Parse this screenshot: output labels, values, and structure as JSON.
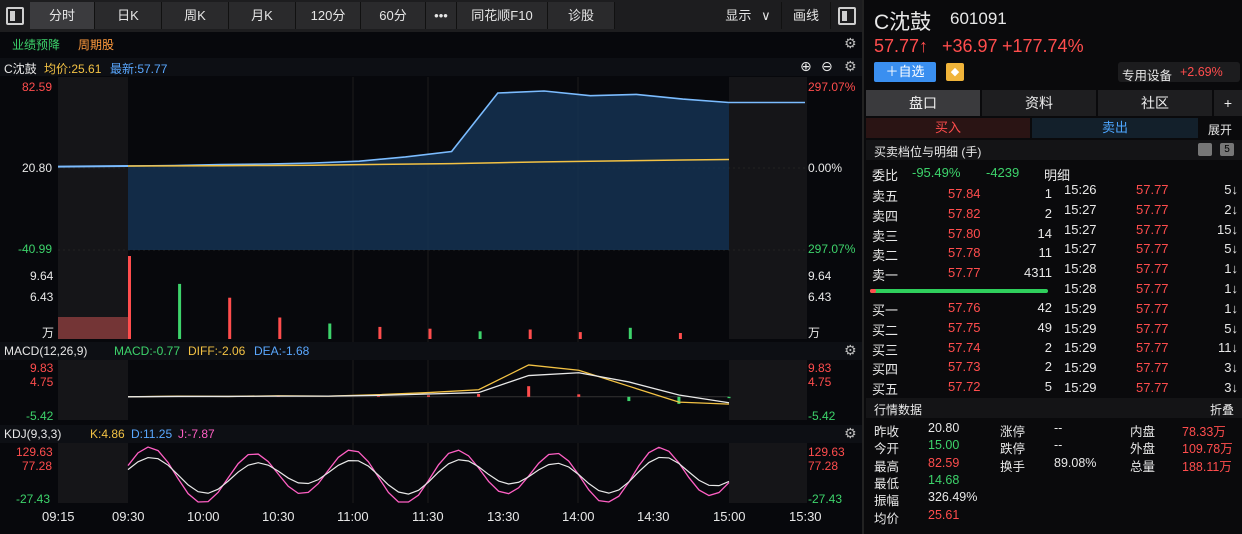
{
  "toolbar": {
    "tabs": [
      "分时",
      "日K",
      "周K",
      "月K",
      "120分",
      "60分",
      "•••",
      "同花顺F10",
      "诊股"
    ],
    "active": "分时",
    "show_label": "显示",
    "draw_label": "画线"
  },
  "chart": {
    "tags": [
      "业绩预降",
      "周期股"
    ],
    "stock_short": "C沈鼓",
    "avg_price_label": "均价:25.61",
    "latest_label": "最新:57.77",
    "price_axis_left": [
      "82.59",
      "20.80",
      "-40.99"
    ],
    "price_axis_right": [
      "297.07%",
      "0.00%",
      "297.07%"
    ],
    "vol_axis_left": [
      "9.64",
      "6.43",
      "万"
    ],
    "vol_axis_right": [
      "9.64",
      "6.43",
      "万"
    ],
    "macd_title": "MACD(12,26,9)",
    "macd_value": "MACD:-0.77",
    "diff_value": "DIFF:-2.06",
    "dea_value": "DEA:-1.68",
    "macd_axis_left": [
      "9.83",
      "4.75",
      "-5.42"
    ],
    "macd_axis_right": [
      "9.83",
      "4.75",
      "-5.42"
    ],
    "kdj_title": "KDJ(9,3,3)",
    "k_value": "K:4.86",
    "d_value": "D:11.25",
    "j_value": "J:-7.87",
    "kdj_axis_left": [
      "129.63",
      "77.28",
      "-27.43"
    ],
    "kdj_axis_right": [
      "129.63",
      "77.28",
      "-27.43"
    ],
    "time_axis": [
      "09:15",
      "09:30",
      "10:00",
      "10:30",
      "11:00",
      "11:30",
      "13:30",
      "14:00",
      "14:30",
      "15:00",
      "15:30"
    ]
  },
  "chart_data": {
    "type": "line",
    "x": [
      "09:30",
      "10:00",
      "10:30",
      "11:00",
      "11:30",
      "13:00",
      "13:15",
      "13:30",
      "13:45",
      "14:00",
      "14:15",
      "14:30",
      "14:45",
      "15:00"
    ],
    "series": [
      {
        "values": [
          20.8,
          21.2,
          21.8,
          22.3,
          23.0,
          24.3,
          27.5,
          31.5,
          74.5,
          76.0,
          72.5,
          73.5,
          70.0,
          67.5
        ]
      },
      {
        "values": [
          20.8,
          20.9,
          21.0,
          21.2,
          21.4,
          21.8,
          22.2,
          22.6,
          23.2,
          23.8,
          24.3,
          24.8,
          25.2,
          25.61
        ]
      }
    ],
    "ylim": [
      -40.99,
      82.59
    ],
    "volume": [
      9.64,
      6.4,
      4.8,
      2.5,
      1.8,
      1.4,
      1.2,
      0.9,
      1.1,
      0.8,
      1.3,
      0.7
    ],
    "macd": {
      "dif": [
        0,
        0.2,
        0.1,
        0.3,
        0.2,
        0.6,
        1.2,
        2.0,
        9.0,
        7.5,
        3.0,
        -1.5,
        -2.06
      ],
      "dea": [
        0,
        0.1,
        0.1,
        0.2,
        0.2,
        0.4,
        0.8,
        1.2,
        6.0,
        6.8,
        4.2,
        0.5,
        -1.68
      ],
      "ylim": [
        -5.42,
        9.83
      ]
    },
    "kdj": {
      "ylim": [
        -27.43,
        129.63
      ]
    }
  },
  "right": {
    "name": "C沈鼓",
    "code": "601091",
    "price": "57.77↑",
    "change": "+36.97",
    "change_pct": "+177.74%",
    "add_btn": "＋自选",
    "sector_name": "专用设备",
    "sector_pct": "+2.69%",
    "tabs": [
      "盘口",
      "资料",
      "社区"
    ],
    "plus": "+",
    "buy_btn": "买入",
    "sell_btn": "卖出",
    "expand": "展开",
    "section_title": "买卖档位与明细 (手)",
    "weibi_label": "委比",
    "weibi_pct": "-95.49%",
    "weibi_val": "-4239",
    "detail_label": "明细",
    "asks": [
      {
        "label": "卖五",
        "price": "57.84",
        "vol": "1"
      },
      {
        "label": "卖四",
        "price": "57.82",
        "vol": "2"
      },
      {
        "label": "卖三",
        "price": "57.80",
        "vol": "14"
      },
      {
        "label": "卖二",
        "price": "57.78",
        "vol": "11"
      },
      {
        "label": "卖一",
        "price": "57.77",
        "vol": "4311"
      }
    ],
    "bids": [
      {
        "label": "买一",
        "price": "57.76",
        "vol": "42"
      },
      {
        "label": "买二",
        "price": "57.75",
        "vol": "49"
      },
      {
        "label": "买三",
        "price": "57.74",
        "vol": "2"
      },
      {
        "label": "买四",
        "price": "57.73",
        "vol": "2"
      },
      {
        "label": "买五",
        "price": "57.72",
        "vol": "5"
      }
    ],
    "ticks": [
      {
        "t": "15:26",
        "p": "57.77",
        "v": "5↓"
      },
      {
        "t": "15:27",
        "p": "57.77",
        "v": "2↓"
      },
      {
        "t": "15:27",
        "p": "57.77",
        "v": "15↓"
      },
      {
        "t": "15:27",
        "p": "57.77",
        "v": "5↓"
      },
      {
        "t": "15:28",
        "p": "57.77",
        "v": "1↓"
      },
      {
        "t": "15:28",
        "p": "57.77",
        "v": "1↓"
      },
      {
        "t": "15:29",
        "p": "57.77",
        "v": "1↓"
      },
      {
        "t": "15:29",
        "p": "57.77",
        "v": "5↓"
      },
      {
        "t": "15:29",
        "p": "57.77",
        "v": "11↓"
      },
      {
        "t": "15:29",
        "p": "57.77",
        "v": "3↓"
      },
      {
        "t": "15:29",
        "p": "57.77",
        "v": "3↓"
      }
    ],
    "market_title": "行情数据",
    "fold": "折叠",
    "stats": [
      {
        "a": "昨收",
        "av": "20.80",
        "b": "涨停",
        "bv": "--",
        "c": "内盘",
        "cv": "78.33万"
      },
      {
        "a": "今开",
        "av": "15.00",
        "b": "跌停",
        "bv": "--",
        "c": "外盘",
        "cv": "109.78万"
      },
      {
        "a": "最高",
        "av": "82.59",
        "b": "换手",
        "bv": "89.08%",
        "c": "总量",
        "cv": "188.11万"
      },
      {
        "a": "最低",
        "av": "14.68",
        "b": "",
        "bv": "",
        "c": "",
        "cv": ""
      },
      {
        "a": "振幅",
        "av": "326.49%",
        "b": "",
        "bv": "",
        "c": "",
        "cv": ""
      },
      {
        "a": "均价",
        "av": "25.61",
        "b": "",
        "bv": "",
        "c": "",
        "cv": ""
      }
    ]
  }
}
